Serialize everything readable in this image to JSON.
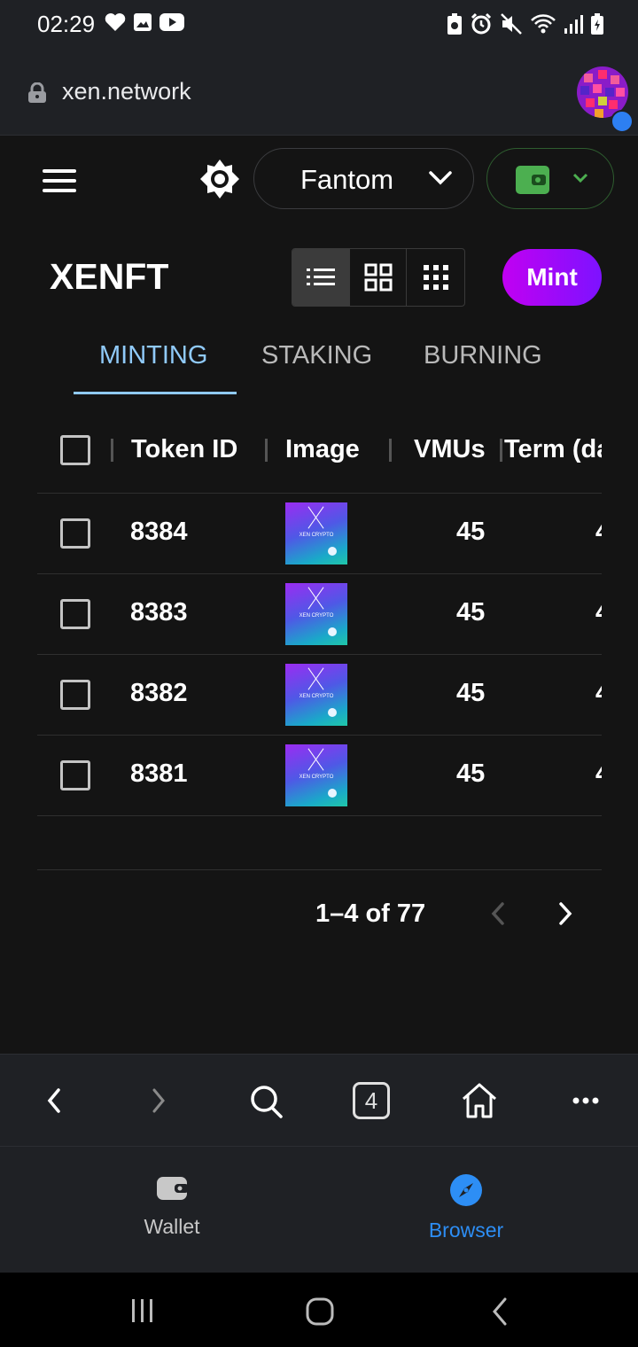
{
  "status_bar": {
    "time": "02:29"
  },
  "browser": {
    "url": "xen.network",
    "tab_count": "4"
  },
  "header": {
    "network": "Fantom"
  },
  "main": {
    "title": "XENFT",
    "mint_label": "Mint",
    "tabs": [
      {
        "label": "MINTING",
        "active": true
      },
      {
        "label": "STAKING",
        "active": false
      },
      {
        "label": "BURNING",
        "active": false
      }
    ],
    "table": {
      "columns": [
        "Token ID",
        "Image",
        "VMUs",
        "Term (da"
      ],
      "rows": [
        {
          "token_id": "8384",
          "vmus": "45",
          "term": "4"
        },
        {
          "token_id": "8383",
          "vmus": "45",
          "term": "4"
        },
        {
          "token_id": "8382",
          "vmus": "45",
          "term": "4"
        },
        {
          "token_id": "8381",
          "vmus": "45",
          "term": "4"
        }
      ],
      "thumb_text": "XEN CRYPTO"
    },
    "pagination": "1–4 of 77"
  },
  "bottom_tabs": [
    {
      "label": "Wallet",
      "active": false
    },
    {
      "label": "Browser",
      "active": true
    }
  ],
  "colors": {
    "accent": "#90caf9",
    "mint_start": "#c100f2",
    "mint_end": "#7d12ff",
    "wallet_green": "#4caf50",
    "browser_blue": "#2d8ef5"
  }
}
